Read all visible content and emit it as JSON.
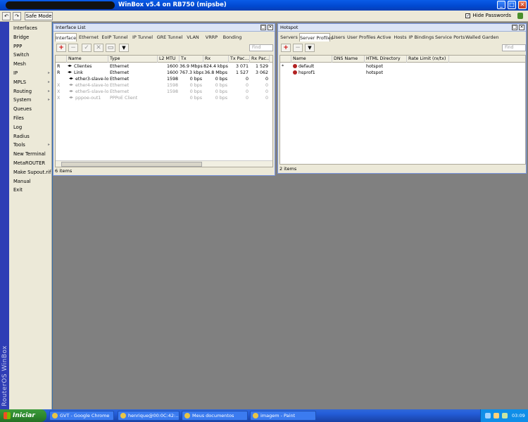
{
  "window": {
    "title": "WinBox v5.4 on RB750 (mipsbe)",
    "min": "_",
    "max": "□",
    "close": "✕"
  },
  "toolbar": {
    "safe_mode": "Safe Mode",
    "hide_passwords": "Hide Passwords",
    "hide_checked": "✓"
  },
  "brand": "RouterOS WinBox",
  "sidemenu": [
    {
      "label": "Interfaces",
      "sub": false
    },
    {
      "label": "Bridge",
      "sub": false
    },
    {
      "label": "PPP",
      "sub": false
    },
    {
      "label": "Switch",
      "sub": false
    },
    {
      "label": "Mesh",
      "sub": false
    },
    {
      "label": "IP",
      "sub": true
    },
    {
      "label": "MPLS",
      "sub": true
    },
    {
      "label": "Routing",
      "sub": true
    },
    {
      "label": "System",
      "sub": true
    },
    {
      "label": "Queues",
      "sub": false
    },
    {
      "label": "Files",
      "sub": false
    },
    {
      "label": "Log",
      "sub": false
    },
    {
      "label": "Radius",
      "sub": false
    },
    {
      "label": "Tools",
      "sub": true
    },
    {
      "label": "New Terminal",
      "sub": false
    },
    {
      "label": "MetaROUTER",
      "sub": false
    },
    {
      "label": "Make Supout.rif",
      "sub": false
    },
    {
      "label": "Manual",
      "sub": false
    },
    {
      "label": "Exit",
      "sub": false
    }
  ],
  "submenu_arrow": "▸",
  "iface": {
    "title": "Interface List",
    "tabs": [
      "Interface",
      "Ethernet",
      "EoIP Tunnel",
      "IP Tunnel",
      "GRE Tunnel",
      "VLAN",
      "VRRP",
      "Bonding"
    ],
    "find": "Find",
    "columns": [
      "",
      "Name",
      "Type",
      "L2 MTU",
      "Tx",
      "Rx",
      "Tx Pac...",
      "Rx Pac..."
    ],
    "rows": [
      {
        "flag": "R",
        "name": "Clientes",
        "type": "Ethernet",
        "mtu": "1600",
        "tx": "36.9 Mbps",
        "rx": "824.4 kbps",
        "txp": "3 071",
        "rxp": "1 529",
        "disabled": false,
        "indent": false
      },
      {
        "flag": "R",
        "name": "Link",
        "type": "Ethernet",
        "mtu": "1600",
        "tx": "767.3 kbps",
        "rx": "36.8 Mbps",
        "txp": "1 527",
        "rxp": "3 062",
        "disabled": false,
        "indent": false
      },
      {
        "flag": "",
        "name": "ether3-slave-lo...",
        "type": "Ethernet",
        "mtu": "1598",
        "tx": "0 bps",
        "rx": "0 bps",
        "txp": "0",
        "rxp": "0",
        "disabled": false,
        "indent": true
      },
      {
        "flag": "X",
        "name": "ether4-slave-lo...",
        "type": "Ethernet",
        "mtu": "1598",
        "tx": "0 bps",
        "rx": "0 bps",
        "txp": "0",
        "rxp": "0",
        "disabled": true,
        "indent": true
      },
      {
        "flag": "X",
        "name": "ether5-slave-lo...",
        "type": "Ethernet",
        "mtu": "1598",
        "tx": "0 bps",
        "rx": "0 bps",
        "txp": "0",
        "rxp": "0",
        "disabled": true,
        "indent": true
      },
      {
        "flag": "X",
        "name": "pppoe-out1",
        "type": "PPPoE Client",
        "mtu": "",
        "tx": "0 bps",
        "rx": "0 bps",
        "txp": "0",
        "rxp": "0",
        "disabled": true,
        "indent": true
      }
    ],
    "status": "6 items"
  },
  "hotspot": {
    "title": "Hotspot",
    "tabs": [
      "Servers",
      "Server Profiles",
      "Users",
      "User Profiles",
      "Active",
      "Hosts",
      "IP Bindings",
      "Service Ports",
      "Walled Garden"
    ],
    "active_tab": 1,
    "find": "Find",
    "columns": [
      "",
      "Name",
      "DNS Name",
      "HTML Directory",
      "Rate Limit (rx/tx)"
    ],
    "rows": [
      {
        "flag": "*",
        "name": "default",
        "dns": "",
        "html": "hotspot",
        "rate": ""
      },
      {
        "flag": "",
        "name": "hsprof1",
        "dns": "",
        "html": "hotspot",
        "rate": ""
      }
    ],
    "status": "2 items"
  },
  "icons": {
    "add": "+",
    "remove": "−",
    "enable": "✓",
    "disable": "✕",
    "comment": "▭",
    "filter": "▼"
  },
  "taskbar": {
    "start": "Iniciar",
    "tasks": [
      "GVT - Google Chrome",
      "henrique@00:0C:42:...",
      "Meus documentos",
      "imagem - Paint"
    ],
    "clock": "03:09"
  }
}
